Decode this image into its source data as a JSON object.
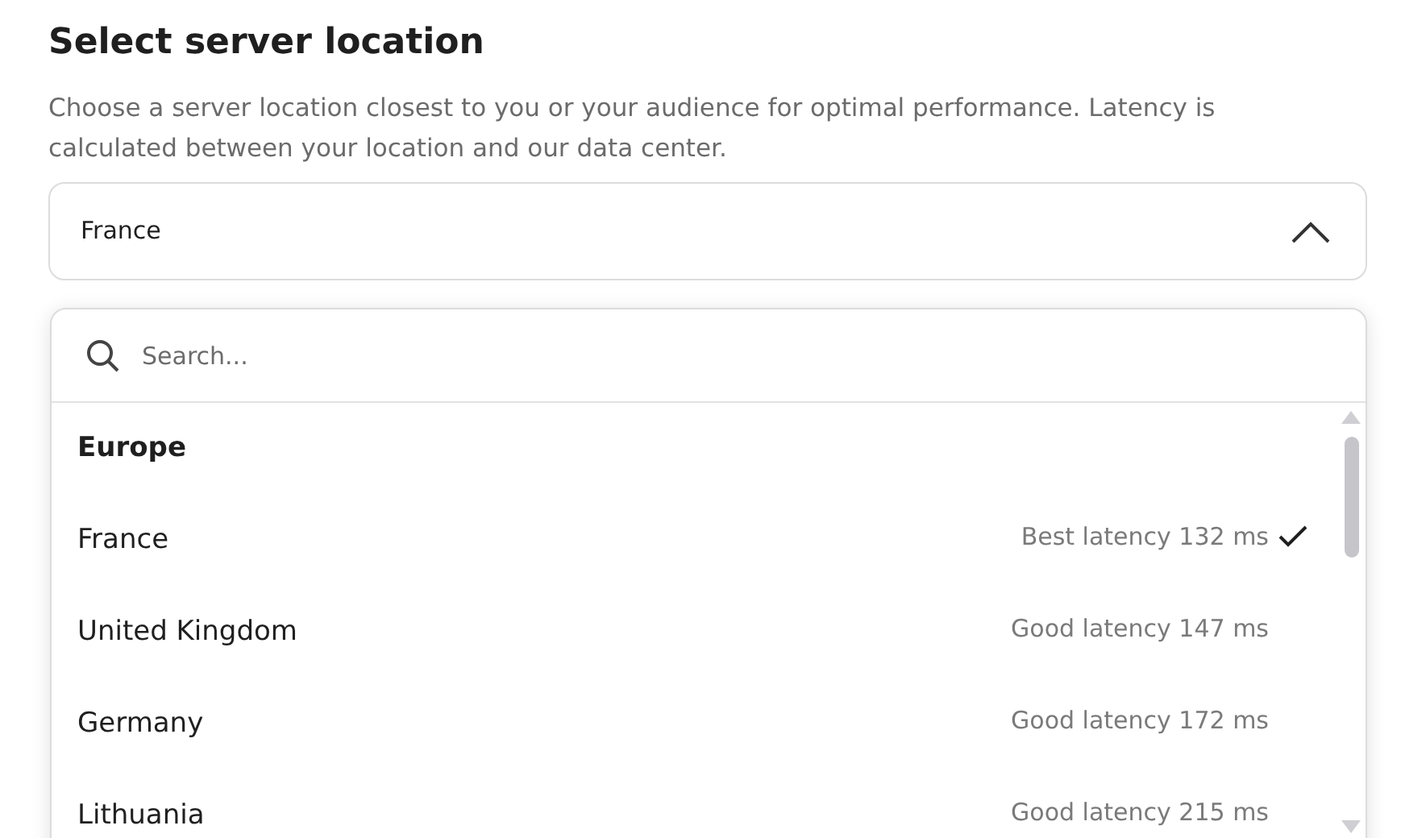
{
  "title": "Select server location",
  "description": "Choose a server location closest to you or your audience for optimal performance. Latency is calculated between your location and our data center.",
  "select": {
    "value": "France",
    "expanded": true
  },
  "search": {
    "placeholder": "Search..."
  },
  "groups": [
    {
      "label": "Europe",
      "options": [
        {
          "name": "France",
          "latency": "Best latency 132 ms",
          "selected": true
        },
        {
          "name": "United Kingdom",
          "latency": "Good latency 147 ms",
          "selected": false
        },
        {
          "name": "Germany",
          "latency": "Good latency 172 ms",
          "selected": false
        },
        {
          "name": "Lithuania",
          "latency": "Good latency 215 ms",
          "selected": false
        }
      ]
    }
  ]
}
